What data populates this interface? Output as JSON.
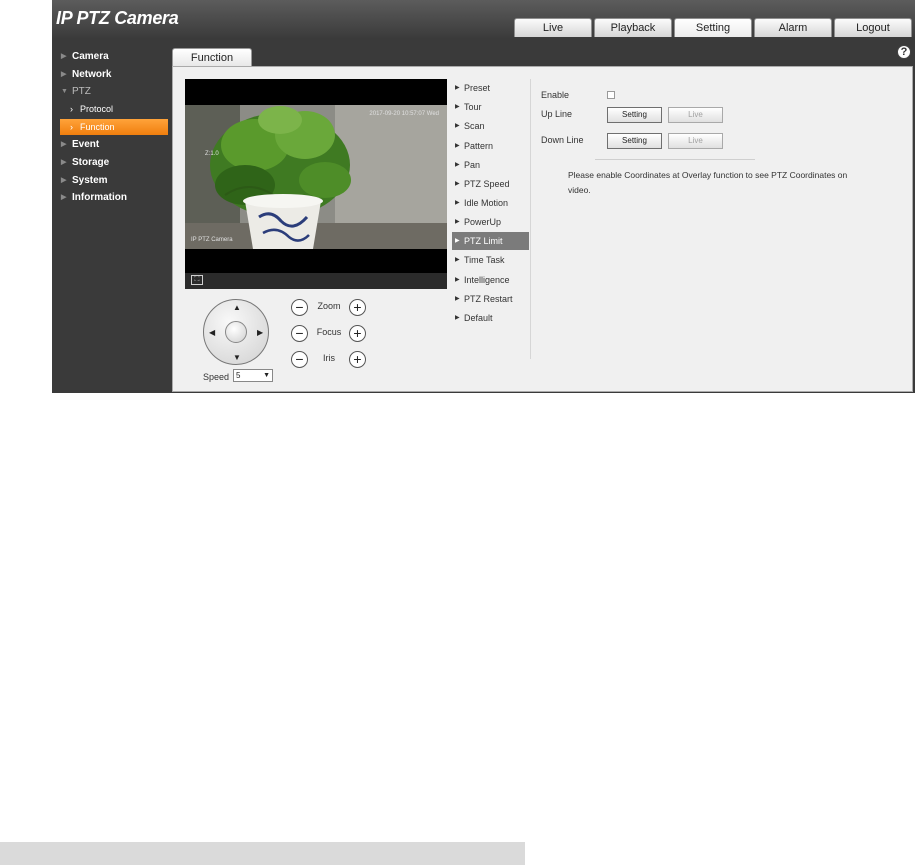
{
  "brand": "IP PTZ Camera",
  "top_tabs": [
    "Live",
    "Playback",
    "Setting",
    "Alarm",
    "Logout"
  ],
  "active_top_tab": "Setting",
  "sidebar": {
    "items": [
      {
        "label": "Camera"
      },
      {
        "label": "Network"
      },
      {
        "label": "PTZ"
      },
      {
        "label": "Protocol"
      },
      {
        "label": "Function"
      },
      {
        "label": "Event"
      },
      {
        "label": "Storage"
      },
      {
        "label": "System"
      },
      {
        "label": "Information"
      }
    ],
    "selected": "Function"
  },
  "content_tab": "Function",
  "help_icon": "?",
  "video": {
    "timestamp": "2017-09-20 10:57:07 Wed",
    "zoom_text": "Z:1.0",
    "camera_name": "IP PTZ Camera",
    "fullscreen_icon": "⛶"
  },
  "ptz_controls": {
    "zoom_label": "Zoom",
    "focus_label": "Focus",
    "iris_label": "Iris",
    "minus": "−",
    "plus": "+",
    "speed_label": "Speed",
    "speed_value": "5",
    "up": "▲",
    "down": "▼",
    "left": "◀",
    "right": "▶",
    "caret": "▼"
  },
  "function_menu": {
    "items": [
      "Preset",
      "Tour",
      "Scan",
      "Pattern",
      "Pan",
      "PTZ Speed",
      "Idle Motion",
      "PowerUp",
      "PTZ Limit",
      "Time Task",
      "Intelligence",
      "PTZ Restart",
      "Default"
    ],
    "selected": "PTZ Limit",
    "bullet": "▶"
  },
  "form": {
    "enable_label": "Enable",
    "up_line_label": "Up Line",
    "down_line_label": "Down Line",
    "setting_button": "Setting",
    "live_button": "Live",
    "note": "Please enable Coordinates at Overlay function to see PTZ Coordinates on video."
  },
  "colors": {
    "accent_orange": "#f7931e",
    "dark_bg": "#3a3a3a",
    "panel_bg": "#f0f0f0",
    "menu_selected": "#7b7b7b"
  }
}
